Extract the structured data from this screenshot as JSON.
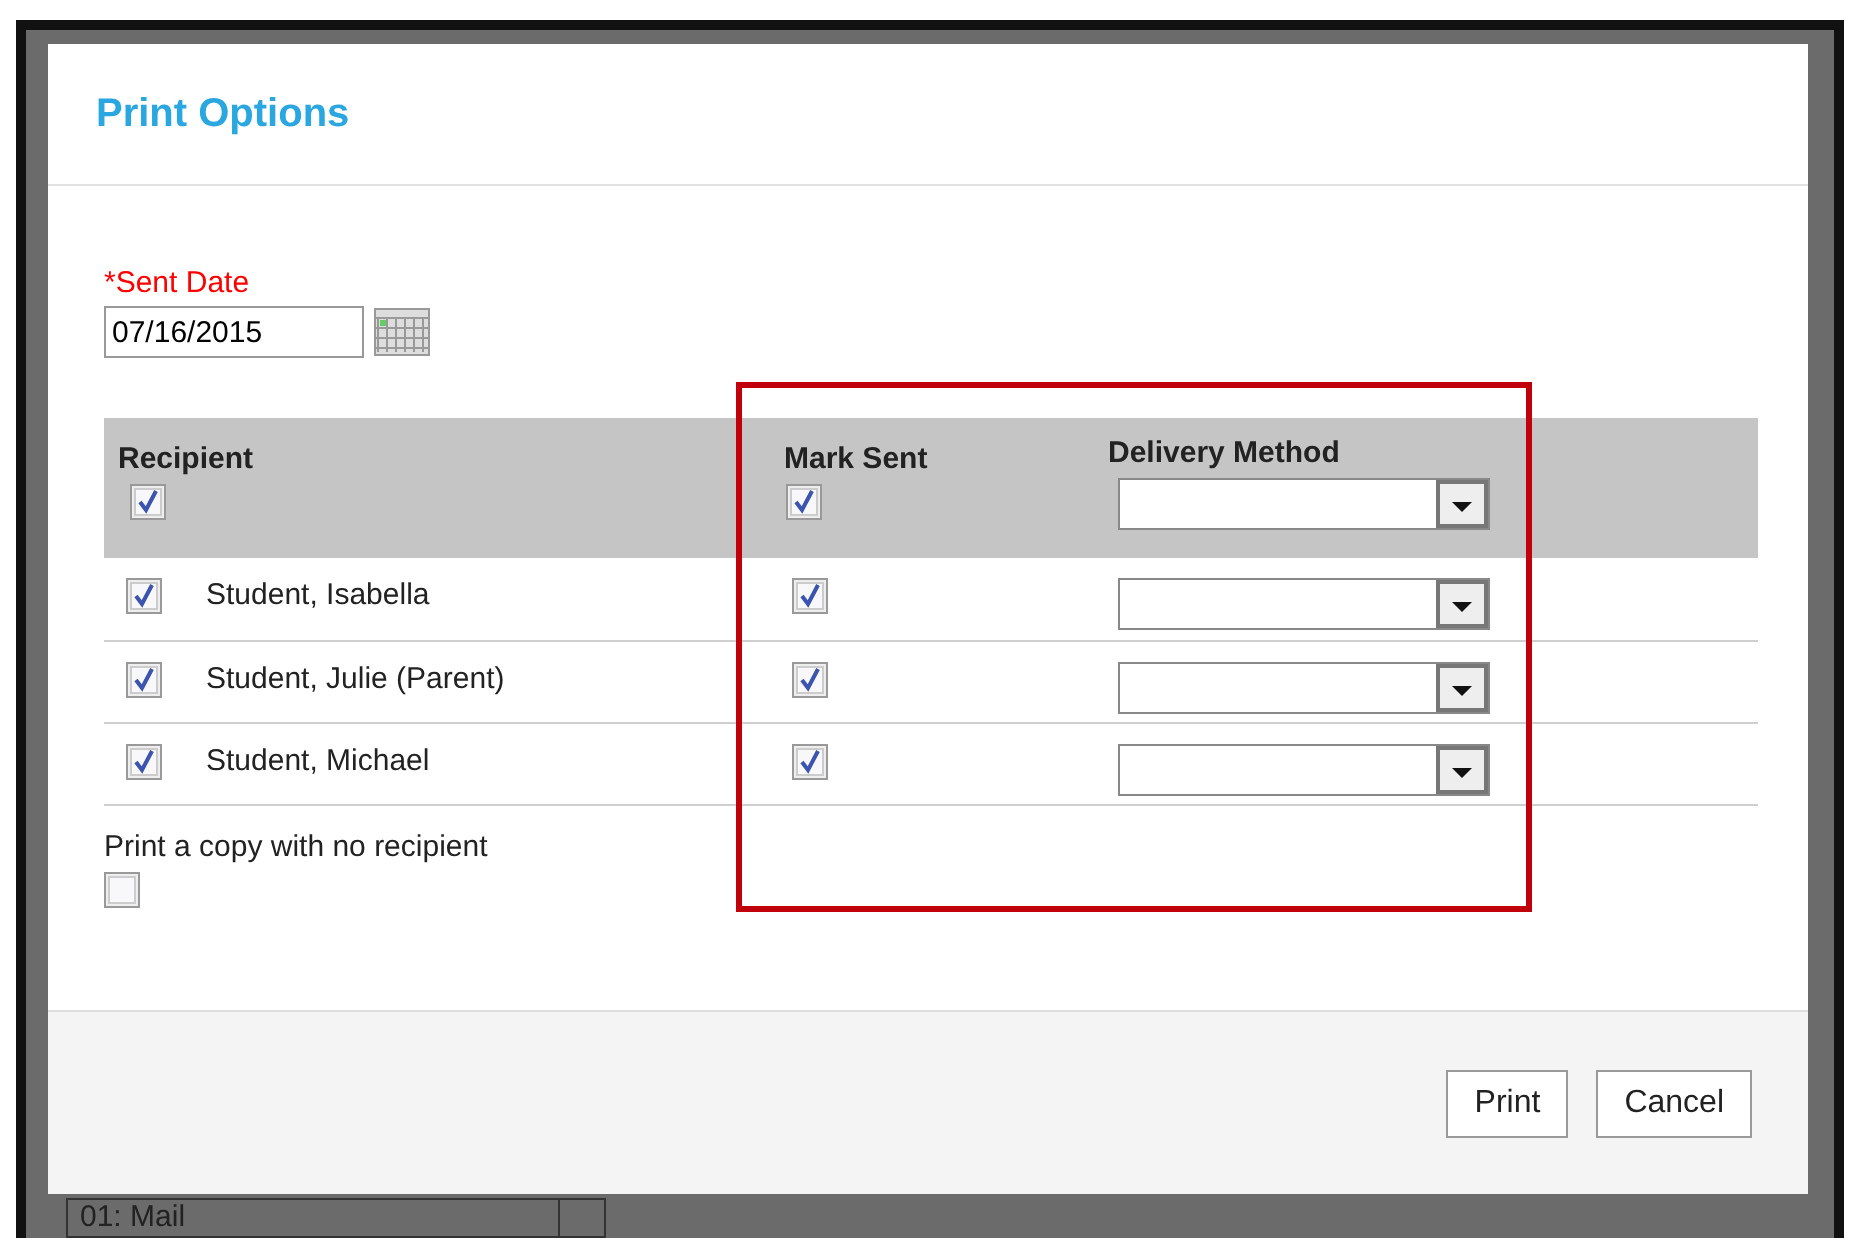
{
  "dialog": {
    "title": "Print Options",
    "sent_date": {
      "label": "*Sent Date",
      "value": "07/16/2015"
    },
    "table": {
      "columns": [
        "Recipient",
        "Mark Sent",
        "Delivery Method"
      ],
      "all_recipients_checked": true,
      "all_mark_sent_checked": true,
      "rows": [
        {
          "name": "Student, Isabella",
          "checked": true,
          "mark_sent": true
        },
        {
          "name": "Student, Julie (Parent)",
          "checked": true,
          "mark_sent": true
        },
        {
          "name": "Student, Michael",
          "checked": true,
          "mark_sent": true
        }
      ]
    },
    "no_recipient": {
      "label": "Print a copy with no recipient",
      "checked": false
    },
    "buttons": [
      "Print",
      "Cancel"
    ]
  },
  "background": {
    "delivery_field": "01: Mail"
  }
}
